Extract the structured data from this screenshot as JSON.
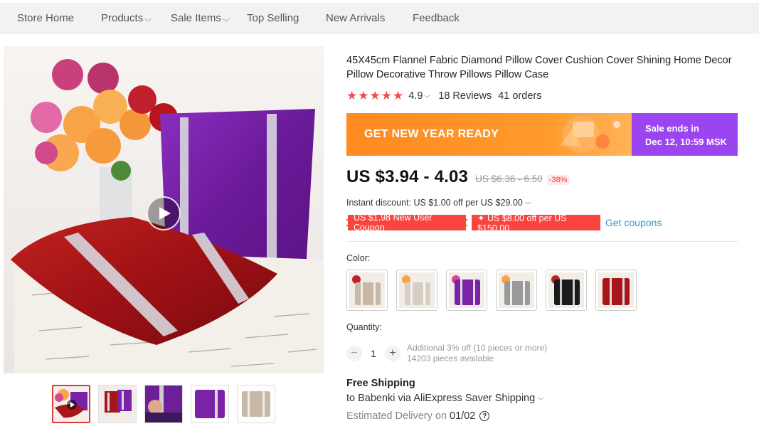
{
  "nav": {
    "items": [
      {
        "label": "Store Home",
        "has_dropdown": false
      },
      {
        "label": "Products",
        "has_dropdown": true
      },
      {
        "label": "Sale Items",
        "has_dropdown": true
      },
      {
        "label": "Top Selling",
        "has_dropdown": false
      },
      {
        "label": "New Arrivals",
        "has_dropdown": false
      },
      {
        "label": "Feedback",
        "has_dropdown": false
      }
    ]
  },
  "gallery": {
    "thumbnail_count": 5,
    "active_thumbnail": 0
  },
  "product": {
    "title": "45X45cm Flannel Fabric Diamond Pillow Cover Cushion Cover Shining Home Decor Pillow Decorative Throw Pillows Pillow Case",
    "rating": "4.9",
    "stars": 5,
    "reviews": "18 Reviews",
    "orders": "41 orders"
  },
  "banner": {
    "promo_text": "GET NEW YEAR READY",
    "sale_line1": "Sale ends in",
    "sale_line2": "Dec 12, 10:59 MSK"
  },
  "price": {
    "current": "US $3.94 - 4.03",
    "original": "US $6.36 - 6.50",
    "discount": "-38%"
  },
  "instant_discount": "Instant discount: US $1.00 off per US $29.00",
  "coupons": {
    "new_user": "US $1.98 New User Coupon",
    "store": "✦ US $8.00 off per US $150.00",
    "get_link": "Get coupons"
  },
  "color": {
    "label": "Color:",
    "options": [
      {
        "name": "light-khaki",
        "hex": "#c9b8a6"
      },
      {
        "name": "beige",
        "hex": "#d8cfc4"
      },
      {
        "name": "purple",
        "hex": "#7a22a8"
      },
      {
        "name": "grey",
        "hex": "#9a9a9a"
      },
      {
        "name": "black",
        "hex": "#1a1a1a"
      },
      {
        "name": "red",
        "hex": "#a8161b"
      }
    ]
  },
  "quantity": {
    "label": "Quantity:",
    "value": "1",
    "minus": "−",
    "plus": "+",
    "bulk_note": "Additional 3% off (10 pieces or more)",
    "available": "14203 pieces available"
  },
  "shipping": {
    "title": "Free Shipping",
    "to": "to Babenki via AliExpress Saver Shipping",
    "delivery_prefix": "Estimated Delivery on",
    "delivery_date": "01/02",
    "help": "?"
  },
  "colors": {
    "accent_red": "#f34a4a",
    "banner_orange": "#ff8a1f",
    "banner_purple": "#9b45f0",
    "link_blue": "#2e9cca"
  }
}
